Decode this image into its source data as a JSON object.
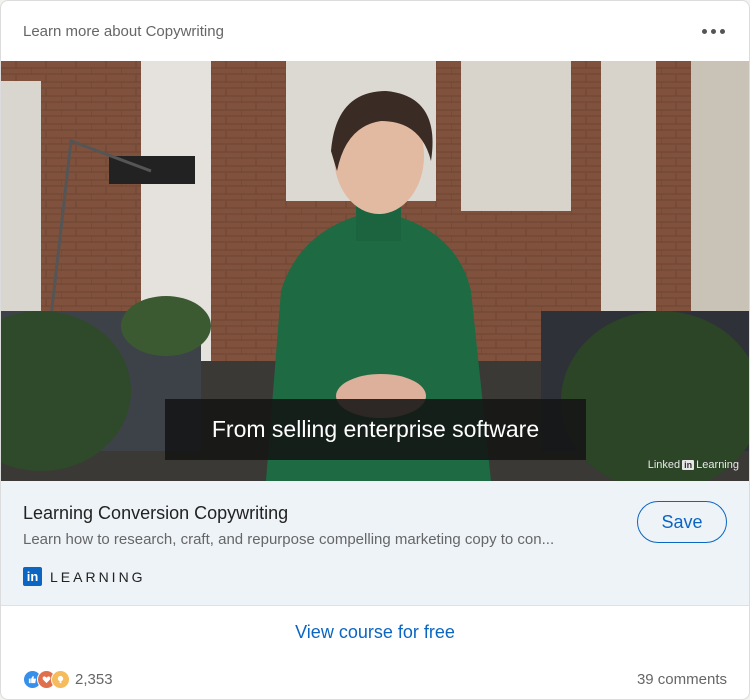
{
  "header": {
    "title": "Learn more about Copywriting"
  },
  "video": {
    "caption": "From selling enterprise software",
    "watermark_brand": "Linked",
    "watermark_in": "in",
    "watermark_suffix": "Learning"
  },
  "course": {
    "title": "Learning Conversion Copywriting",
    "description": "Learn how to research, craft, and repurpose compelling marketing copy to con...",
    "brand_logo": "in",
    "brand_label": "LEARNING",
    "save_label": "Save"
  },
  "cta": {
    "label": "View course for free"
  },
  "social": {
    "reactions_count": "2,353",
    "comments": "39 comments"
  },
  "icons": {
    "more": "more-horizontal-icon",
    "like": "like-icon",
    "love": "love-icon",
    "insight": "insightful-icon"
  },
  "colors": {
    "accent": "#0a66c2",
    "info_bg": "#eef3f8"
  }
}
